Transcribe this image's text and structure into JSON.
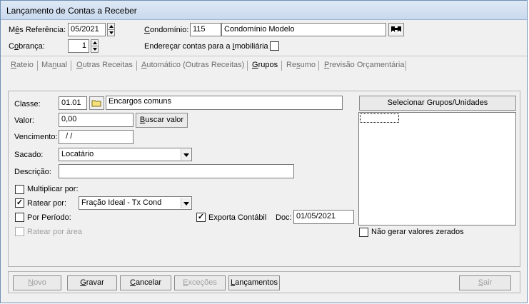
{
  "window": {
    "title": "Lançamento de Contas a Receber"
  },
  "header": {
    "mes_label_pre": "M",
    "mes_label_u": "ê",
    "mes_label_post": "s Referência:",
    "mes_value": "05/2021",
    "condominio_label_pre": "",
    "condominio_label_u": "C",
    "condominio_label_post": "ondomínio:",
    "condominio_code": "115",
    "condominio_name": "Condomínio Modelo",
    "cobranca_label_pre": "C",
    "cobranca_label_u": "o",
    "cobranca_label_post": "brança:",
    "cobranca_value": "1",
    "enderecar_label_pre": "Endereçar contas para a ",
    "enderecar_label_u": "I",
    "enderecar_label_post": "mobiliária",
    "enderecar_checked": false,
    "binoculars_icon": "binoculars-icon"
  },
  "tabs": [
    {
      "label_pre": "",
      "label_u": "R",
      "label_post": "ateio",
      "active": false
    },
    {
      "label_pre": "Ma",
      "label_u": "n",
      "label_post": "ual",
      "active": false
    },
    {
      "label_pre": "",
      "label_u": "O",
      "label_post": "utras Receitas",
      "active": false
    },
    {
      "label_pre": "",
      "label_u": "A",
      "label_post": "utomático (Outras Receitas)",
      "active": false
    },
    {
      "label_pre": "",
      "label_u": "G",
      "label_post": "rupos",
      "active": true
    },
    {
      "label_pre": "Re",
      "label_u": "s",
      "label_post": "umo",
      "active": false
    },
    {
      "label_pre": "",
      "label_u": "P",
      "label_post": "revisão Orçamentária",
      "active": false
    }
  ],
  "form": {
    "classe_label": "Classe:",
    "classe_code": "01.01",
    "classe_desc": "Encargos comuns",
    "valor_label": "Valor:",
    "valor_value": "0,00",
    "buscar_pre": "",
    "buscar_u": "B",
    "buscar_post": "uscar valor",
    "vencimento_label": "Vencimento:",
    "vencimento_value": "  / /",
    "sacado_label": "Sacado:",
    "sacado_value": "Locatário",
    "descricao_label": "Descrição:",
    "descricao_value": "",
    "multiplicar_label": "Multiplicar por:",
    "multiplicar_checked": false,
    "ratear_label": "Ratear por:",
    "ratear_checked": true,
    "ratear_value": "Fração Ideal - Tx Cond",
    "periodo_label": "Por Período:",
    "periodo_checked": false,
    "exporta_label": "Exporta Contábil",
    "exporta_checked": true,
    "doc_label": "Doc:",
    "doc_value": "01/05/2021",
    "area_label": "Ratear por área",
    "area_checked": false
  },
  "right": {
    "selecionar_label": "Selecionar Grupos/Unidades",
    "nao_gerar_label": "Não gerar valores zerados",
    "nao_gerar_checked": false
  },
  "footer": {
    "novo_pre": "",
    "novo_u": "N",
    "novo_post": "ovo",
    "gravar_pre": "",
    "gravar_u": "G",
    "gravar_post": "ravar",
    "cancelar_pre": "",
    "cancelar_u": "C",
    "cancelar_post": "ancelar",
    "excecoes_pre": "",
    "excecoes_u": "E",
    "excecoes_post": "xceções",
    "lancamentos_pre": "",
    "lancamentos_u": "L",
    "lancamentos_post": "ançamentos",
    "sair_pre": "",
    "sair_u": "S",
    "sair_post": "air"
  },
  "colors": {
    "title_bg": "#c9d9ee",
    "window_border": "#6f8fb3",
    "face": "#f0f0f0",
    "folder": "#f5e17a"
  }
}
